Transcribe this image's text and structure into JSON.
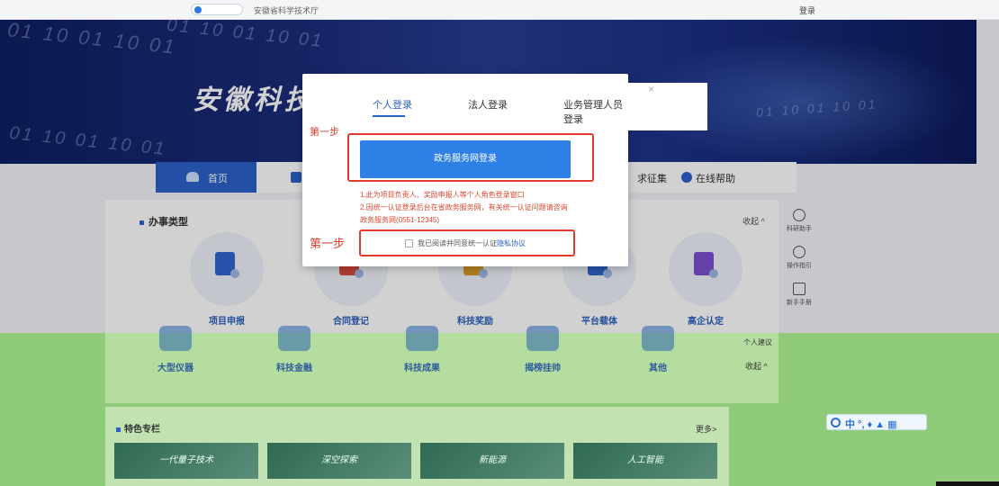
{
  "topbar": {
    "portal_label": "安徽省科学技术厅",
    "login": "登录"
  },
  "banner": {
    "title": "安徽科技大脑",
    "binary_text": "01 10 01 10 01"
  },
  "nav": {
    "home": "首页",
    "partial_item": "求征集",
    "help": "在线帮助"
  },
  "services": {
    "section_title": "办事类型",
    "collapse": "收起 ^",
    "items": [
      {
        "label": "项目申报",
        "icon": "document-icon"
      },
      {
        "label": "合同登记",
        "icon": "contract-icon"
      },
      {
        "label": "科技奖励",
        "icon": "award-icon"
      },
      {
        "label": "平台载体",
        "icon": "platform-icon"
      },
      {
        "label": "高企认定",
        "icon": "enterprise-icon"
      }
    ],
    "row2": [
      {
        "label": "大型仪器"
      },
      {
        "label": "科技金融"
      },
      {
        "label": "科技成果"
      },
      {
        "label": "揭榜挂帅"
      },
      {
        "label": "其他"
      }
    ],
    "collapse2": "收起 ^"
  },
  "tools": [
    {
      "label": "科研助手",
      "icon": "robot-icon"
    },
    {
      "label": "操作指引",
      "icon": "question-icon"
    },
    {
      "label": "新手手册",
      "icon": "book-icon"
    },
    {
      "label": "个人建议",
      "icon": "suggest-icon"
    }
  ],
  "features": {
    "title": "特色专栏",
    "more": "更多>",
    "cards": [
      "一代量子技术",
      "深空探索",
      "新能源",
      "人工智能"
    ]
  },
  "dialog": {
    "tabs": [
      "个人登录",
      "法人登录",
      "业务管理人员登录"
    ],
    "close": "×",
    "step_top": "第一步",
    "gov_login": "政务服务网登录",
    "notes": [
      "1.此为项目负责人、奖励申报人等个人角色登录窗口",
      "2.因统一认证登录后台在省政务服务网，有关统一认证问题请咨询",
      "政务服务网(0551-12345)"
    ],
    "step_label": "第一步",
    "agree_prefix": "我已阅读并同意统一认证",
    "agree_link": "隐私协议"
  },
  "ime": {
    "text": "中 °, ♦ ▲ ▦"
  }
}
